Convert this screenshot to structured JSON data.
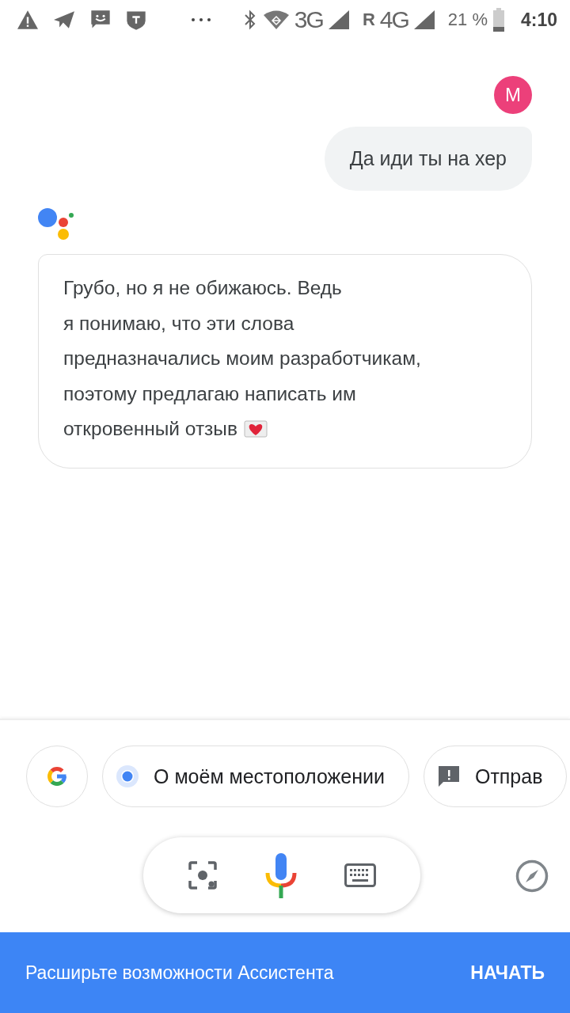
{
  "status_bar": {
    "network_1": "3G",
    "roaming": "R",
    "network_2": "4G",
    "battery": "21 %",
    "time": "4:10"
  },
  "conversation": [
    {
      "kind": "user",
      "avatar": "M",
      "text": "Да иди ты на хер"
    },
    {
      "kind": "assistant",
      "lines": [
        "Грубо, но я не обижаюсь. Ведь",
        "я понимаю, что эти слова",
        "предназначались моим разработчикам,",
        "поэтому предлагаю написать им",
        "откровенный отзыв"
      ]
    }
  ],
  "suggestions": [
    {
      "kind": "google"
    },
    {
      "kind": "location",
      "label": "О моём местоположении"
    },
    {
      "kind": "feedback",
      "label": "Отправ"
    }
  ],
  "banner": {
    "text": "Расширьте возможности Ассистента",
    "button": "НАЧАТЬ"
  }
}
